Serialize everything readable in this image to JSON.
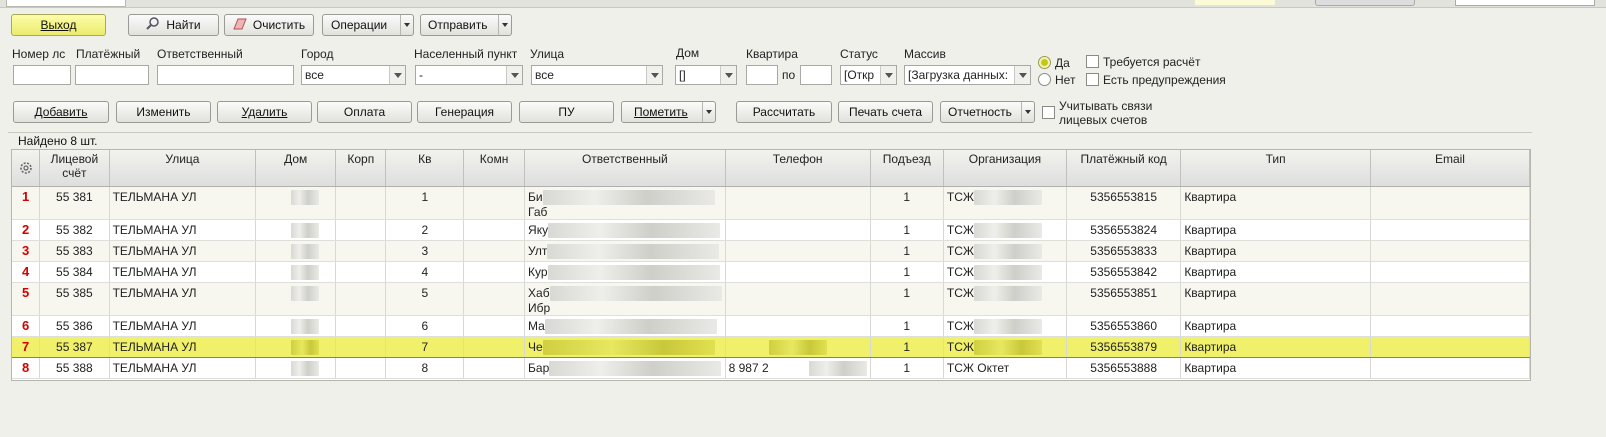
{
  "toolbar": {
    "exit_label": "Выход",
    "find_label": "Найти",
    "clear_label": "Очистить",
    "operations_label": "Операции",
    "send_label": "Отправить"
  },
  "filters": {
    "account_no": {
      "label": "Номер лс",
      "value": ""
    },
    "payment": {
      "label": "Платёжный",
      "value": ""
    },
    "responsible": {
      "label": "Ответственный",
      "value": ""
    },
    "city": {
      "label": "Город",
      "value": "все"
    },
    "locality": {
      "label": "Населенный пункт",
      "value": "-"
    },
    "street": {
      "label": "Улица",
      "value": "все"
    },
    "house": {
      "label": "Дом",
      "value": "[]"
    },
    "apartment": {
      "label": "Квартира",
      "from": "",
      "to_label": "по",
      "to": ""
    },
    "status": {
      "label": "Статус",
      "value": "[Откр"
    },
    "array": {
      "label": "Массив",
      "value": "[Загрузка данных:"
    },
    "yes_label": "Да",
    "no_label": "Нет",
    "calc_required_label": "Требуется расчёт",
    "has_warnings_label": "Есть предупреждения"
  },
  "actions": {
    "add": "Добавить",
    "edit": "Изменить",
    "delete": "Удалить",
    "payment": "Оплата",
    "generation": "Генерация",
    "pu": "ПУ",
    "mark": "Пометить",
    "calculate": "Рассчитать",
    "print_invoice": "Печать счета",
    "reporting": "Отчетность",
    "consider_links_line1": "Учитывать связи",
    "consider_links_line2": "лицевых счетов"
  },
  "found_text": "Найдено 8 шт.",
  "table": {
    "headers": {
      "account": "Лицевой счёт",
      "street": "Улица",
      "house": "Дом",
      "korp": "Корп",
      "kv": "Кв",
      "komn": "Комн",
      "responsible": "Ответственный",
      "phone": "Телефон",
      "entrance": "Подъезд",
      "org": "Организация",
      "paycode": "Платёжный код",
      "type": "Тип",
      "email": "Email"
    },
    "rows": [
      {
        "n": "1",
        "account": "55 381",
        "street": "ТЕЛЬМАНА УЛ",
        "kv": "1",
        "responsible": "Би",
        "responsible2": "Габ",
        "phone": "",
        "entrance": "1",
        "org": "ТСЖ",
        "paycode": "5356553815",
        "type": "Квартира"
      },
      {
        "n": "2",
        "account": "55 382",
        "street": "ТЕЛЬМАНА УЛ",
        "kv": "2",
        "responsible": "Яку",
        "responsible2": "",
        "phone": "",
        "entrance": "1",
        "org": "ТСЖ",
        "paycode": "5356553824",
        "type": "Квартира"
      },
      {
        "n": "3",
        "account": "55 383",
        "street": "ТЕЛЬМАНА УЛ",
        "kv": "3",
        "responsible": "Улт",
        "responsible2": "",
        "phone": "",
        "entrance": "1",
        "org": "ТСЖ",
        "paycode": "5356553833",
        "type": "Квартира"
      },
      {
        "n": "4",
        "account": "55 384",
        "street": "ТЕЛЬМАНА УЛ",
        "kv": "4",
        "responsible": "Кур",
        "responsible2": "",
        "phone": "",
        "entrance": "1",
        "org": "ТСЖ",
        "paycode": "5356553842",
        "type": "Квартира"
      },
      {
        "n": "5",
        "account": "55 385",
        "street": "ТЕЛЬМАНА УЛ",
        "kv": "5",
        "responsible": "Хаб",
        "responsible2": "Ибр",
        "phone": "",
        "entrance": "1",
        "org": "ТСЖ",
        "paycode": "5356553851",
        "type": "Квартира"
      },
      {
        "n": "6",
        "account": "55 386",
        "street": "ТЕЛЬМАНА УЛ",
        "kv": "6",
        "responsible": "Ма",
        "responsible2": "",
        "phone": "",
        "entrance": "1",
        "org": "ТСЖ",
        "paycode": "5356553860",
        "type": "Квартира"
      },
      {
        "n": "7",
        "account": "55 387",
        "street": "ТЕЛЬМАНА УЛ",
        "kv": "7",
        "responsible": "Че",
        "responsible2": "",
        "phone": "",
        "entrance": "1",
        "org": "ТСЖ",
        "paycode": "5356553879",
        "type": "Квартира"
      },
      {
        "n": "8",
        "account": "55 388",
        "street": "ТЕЛЬМАНА УЛ",
        "kv": "8",
        "responsible": "Бар",
        "responsible2": "",
        "phone": "8 987 2",
        "entrance": "1",
        "org": "ТСЖ Октет",
        "paycode": "5356553888",
        "type": "Квартира"
      }
    ]
  }
}
